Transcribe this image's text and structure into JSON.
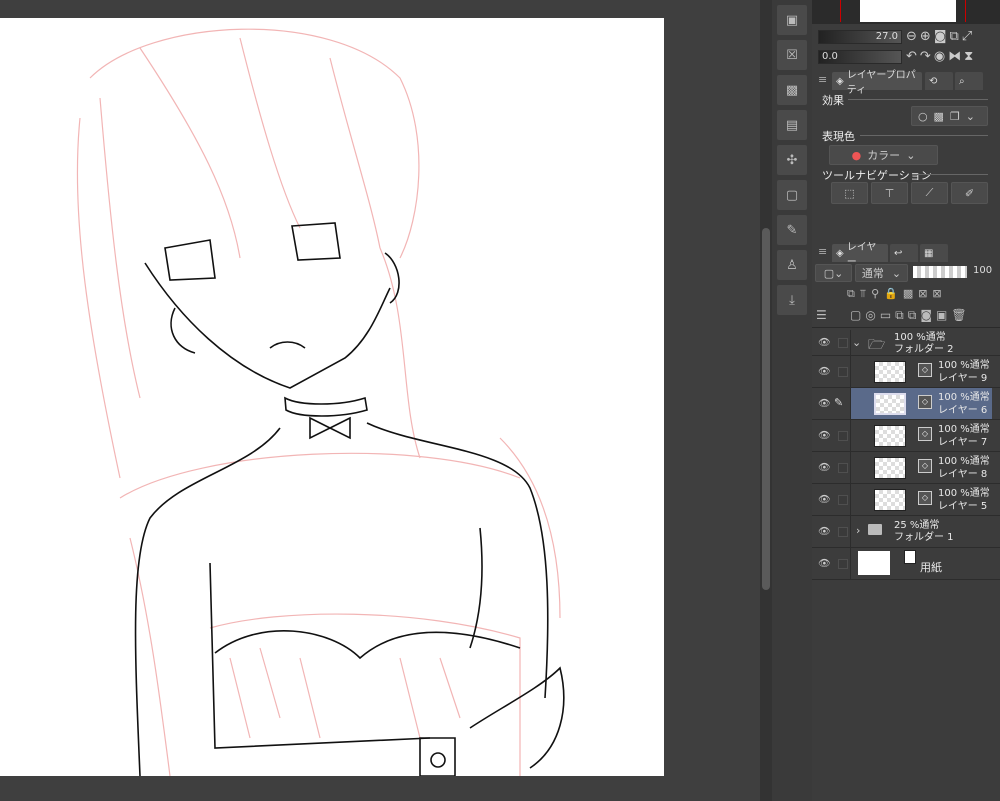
{
  "navigator": {
    "zoom": "27.0",
    "rotation": "0.0"
  },
  "properties": {
    "tabs": [
      "レイヤープロパティ"
    ],
    "effect_label": "効果",
    "color_label": "表現色",
    "color_value": "カラー",
    "toolnav_label": "ツールナビゲーション"
  },
  "layers": {
    "tab_label": "レイヤー",
    "blend_mode": "通常",
    "opacity": "100",
    "items": [
      {
        "opacity_mode": "100 %通常",
        "name": "フォルダー 2",
        "type": "folder",
        "expanded": true,
        "selected": false
      },
      {
        "opacity_mode": "100 %通常",
        "name": "レイヤー 9",
        "type": "layer",
        "selected": false
      },
      {
        "opacity_mode": "100 %通常",
        "name": "レイヤー 6",
        "type": "layer",
        "selected": true
      },
      {
        "opacity_mode": "100 %通常",
        "name": "レイヤー 7",
        "type": "layer",
        "selected": false
      },
      {
        "opacity_mode": "100 %通常",
        "name": "レイヤー 8",
        "type": "layer",
        "selected": false
      },
      {
        "opacity_mode": "100 %通常",
        "name": "レイヤー 5",
        "type": "layer",
        "selected": false
      },
      {
        "opacity_mode": "25 %通常",
        "name": "フォルダー 1",
        "type": "folder",
        "expanded": false,
        "selected": false
      },
      {
        "opacity_mode": "",
        "name": "用紙",
        "type": "paper",
        "selected": false
      }
    ]
  },
  "colors": {
    "sketch": "#f0b8b8",
    "selection": "#5a6a8a"
  }
}
